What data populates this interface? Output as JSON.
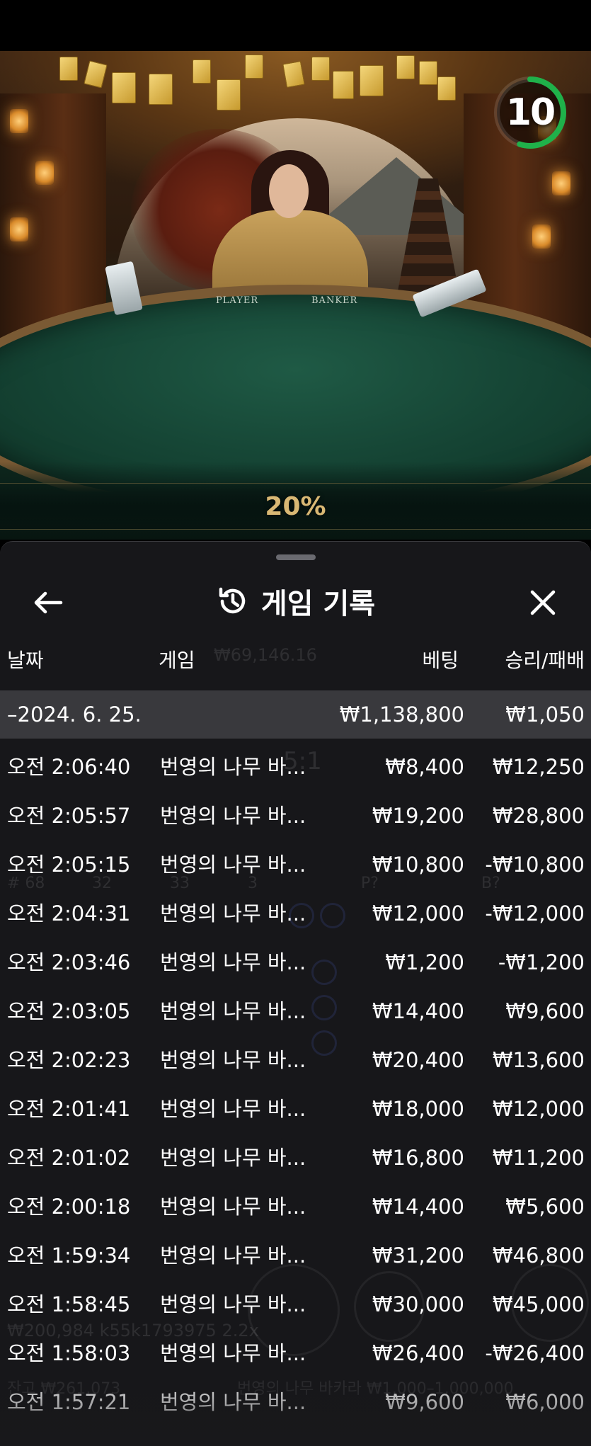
{
  "countdown": {
    "value": "10",
    "progress": 0.55,
    "ring_color": "#1fb14a"
  },
  "bet_multiplier_banner": "20%",
  "table_labels": {
    "player": "PLAYER",
    "banker": "BANKER"
  },
  "history_sheet": {
    "title": "게임 기록",
    "icons": {
      "back": "arrow-left-icon",
      "title": "history-clock-icon",
      "close": "close-x-icon"
    },
    "columns": [
      "날짜",
      "게임",
      "베팅",
      "승리/패배"
    ],
    "summary": {
      "date": "–2024. 6. 25.",
      "bet": "₩1,138,800",
      "result": "₩1,050"
    },
    "rows": [
      {
        "time": "오전 2:06:40",
        "game": "번영의 나무 바...",
        "bet": "₩8,400",
        "result": "₩12,250"
      },
      {
        "time": "오전 2:05:57",
        "game": "번영의 나무 바...",
        "bet": "₩19,200",
        "result": "₩28,800"
      },
      {
        "time": "오전 2:05:15",
        "game": "번영의 나무 바...",
        "bet": "₩10,800",
        "result": "-₩10,800"
      },
      {
        "time": "오전 2:04:31",
        "game": "번영의 나무 바...",
        "bet": "₩12,000",
        "result": "-₩12,000"
      },
      {
        "time": "오전 2:03:46",
        "game": "번영의 나무 바...",
        "bet": "₩1,200",
        "result": "-₩1,200"
      },
      {
        "time": "오전 2:03:05",
        "game": "번영의 나무 바...",
        "bet": "₩14,400",
        "result": "₩9,600"
      },
      {
        "time": "오전 2:02:23",
        "game": "번영의 나무 바...",
        "bet": "₩20,400",
        "result": "₩13,600"
      },
      {
        "time": "오전 2:01:41",
        "game": "번영의 나무 바...",
        "bet": "₩18,000",
        "result": "₩12,000"
      },
      {
        "time": "오전 2:01:02",
        "game": "번영의 나무 바...",
        "bet": "₩16,800",
        "result": "₩11,200"
      },
      {
        "time": "오전 2:00:18",
        "game": "번영의 나무 바...",
        "bet": "₩14,400",
        "result": "₩5,600"
      },
      {
        "time": "오전 1:59:34",
        "game": "번영의 나무 바...",
        "bet": "₩31,200",
        "result": "₩46,800"
      },
      {
        "time": "오전 1:58:45",
        "game": "번영의 나무 바...",
        "bet": "₩30,000",
        "result": "₩45,000"
      },
      {
        "time": "오전 1:58:03",
        "game": "번영의 나무 바...",
        "bet": "₩26,400",
        "result": "-₩26,400"
      },
      {
        "time": "오전 1:57:21",
        "game": "번영의 나무 바...",
        "bet": "₩9,600",
        "result": "₩6,000"
      }
    ]
  },
  "background_overlay": {
    "balance_text": "₩69,146.16",
    "player_pays": "5:1",
    "bead_counts": {
      "total": "# 68",
      "player": "32",
      "banker": "33",
      "tie": "3"
    },
    "predict_labels": {
      "player": "P?",
      "banker": "B?"
    },
    "footer_balance": "₩200,984 k55k1793975 2.2x",
    "footer_total": "잔고 ₩261,073",
    "footer_game": "번영의 나무 바카라 ₩1,000–1,000,000"
  },
  "colors": {
    "sheet_bg": "#18181b",
    "summary_bg": "#39393d",
    "text": "#ffffff",
    "gold": "#d9b874",
    "table_green": "#154434"
  }
}
